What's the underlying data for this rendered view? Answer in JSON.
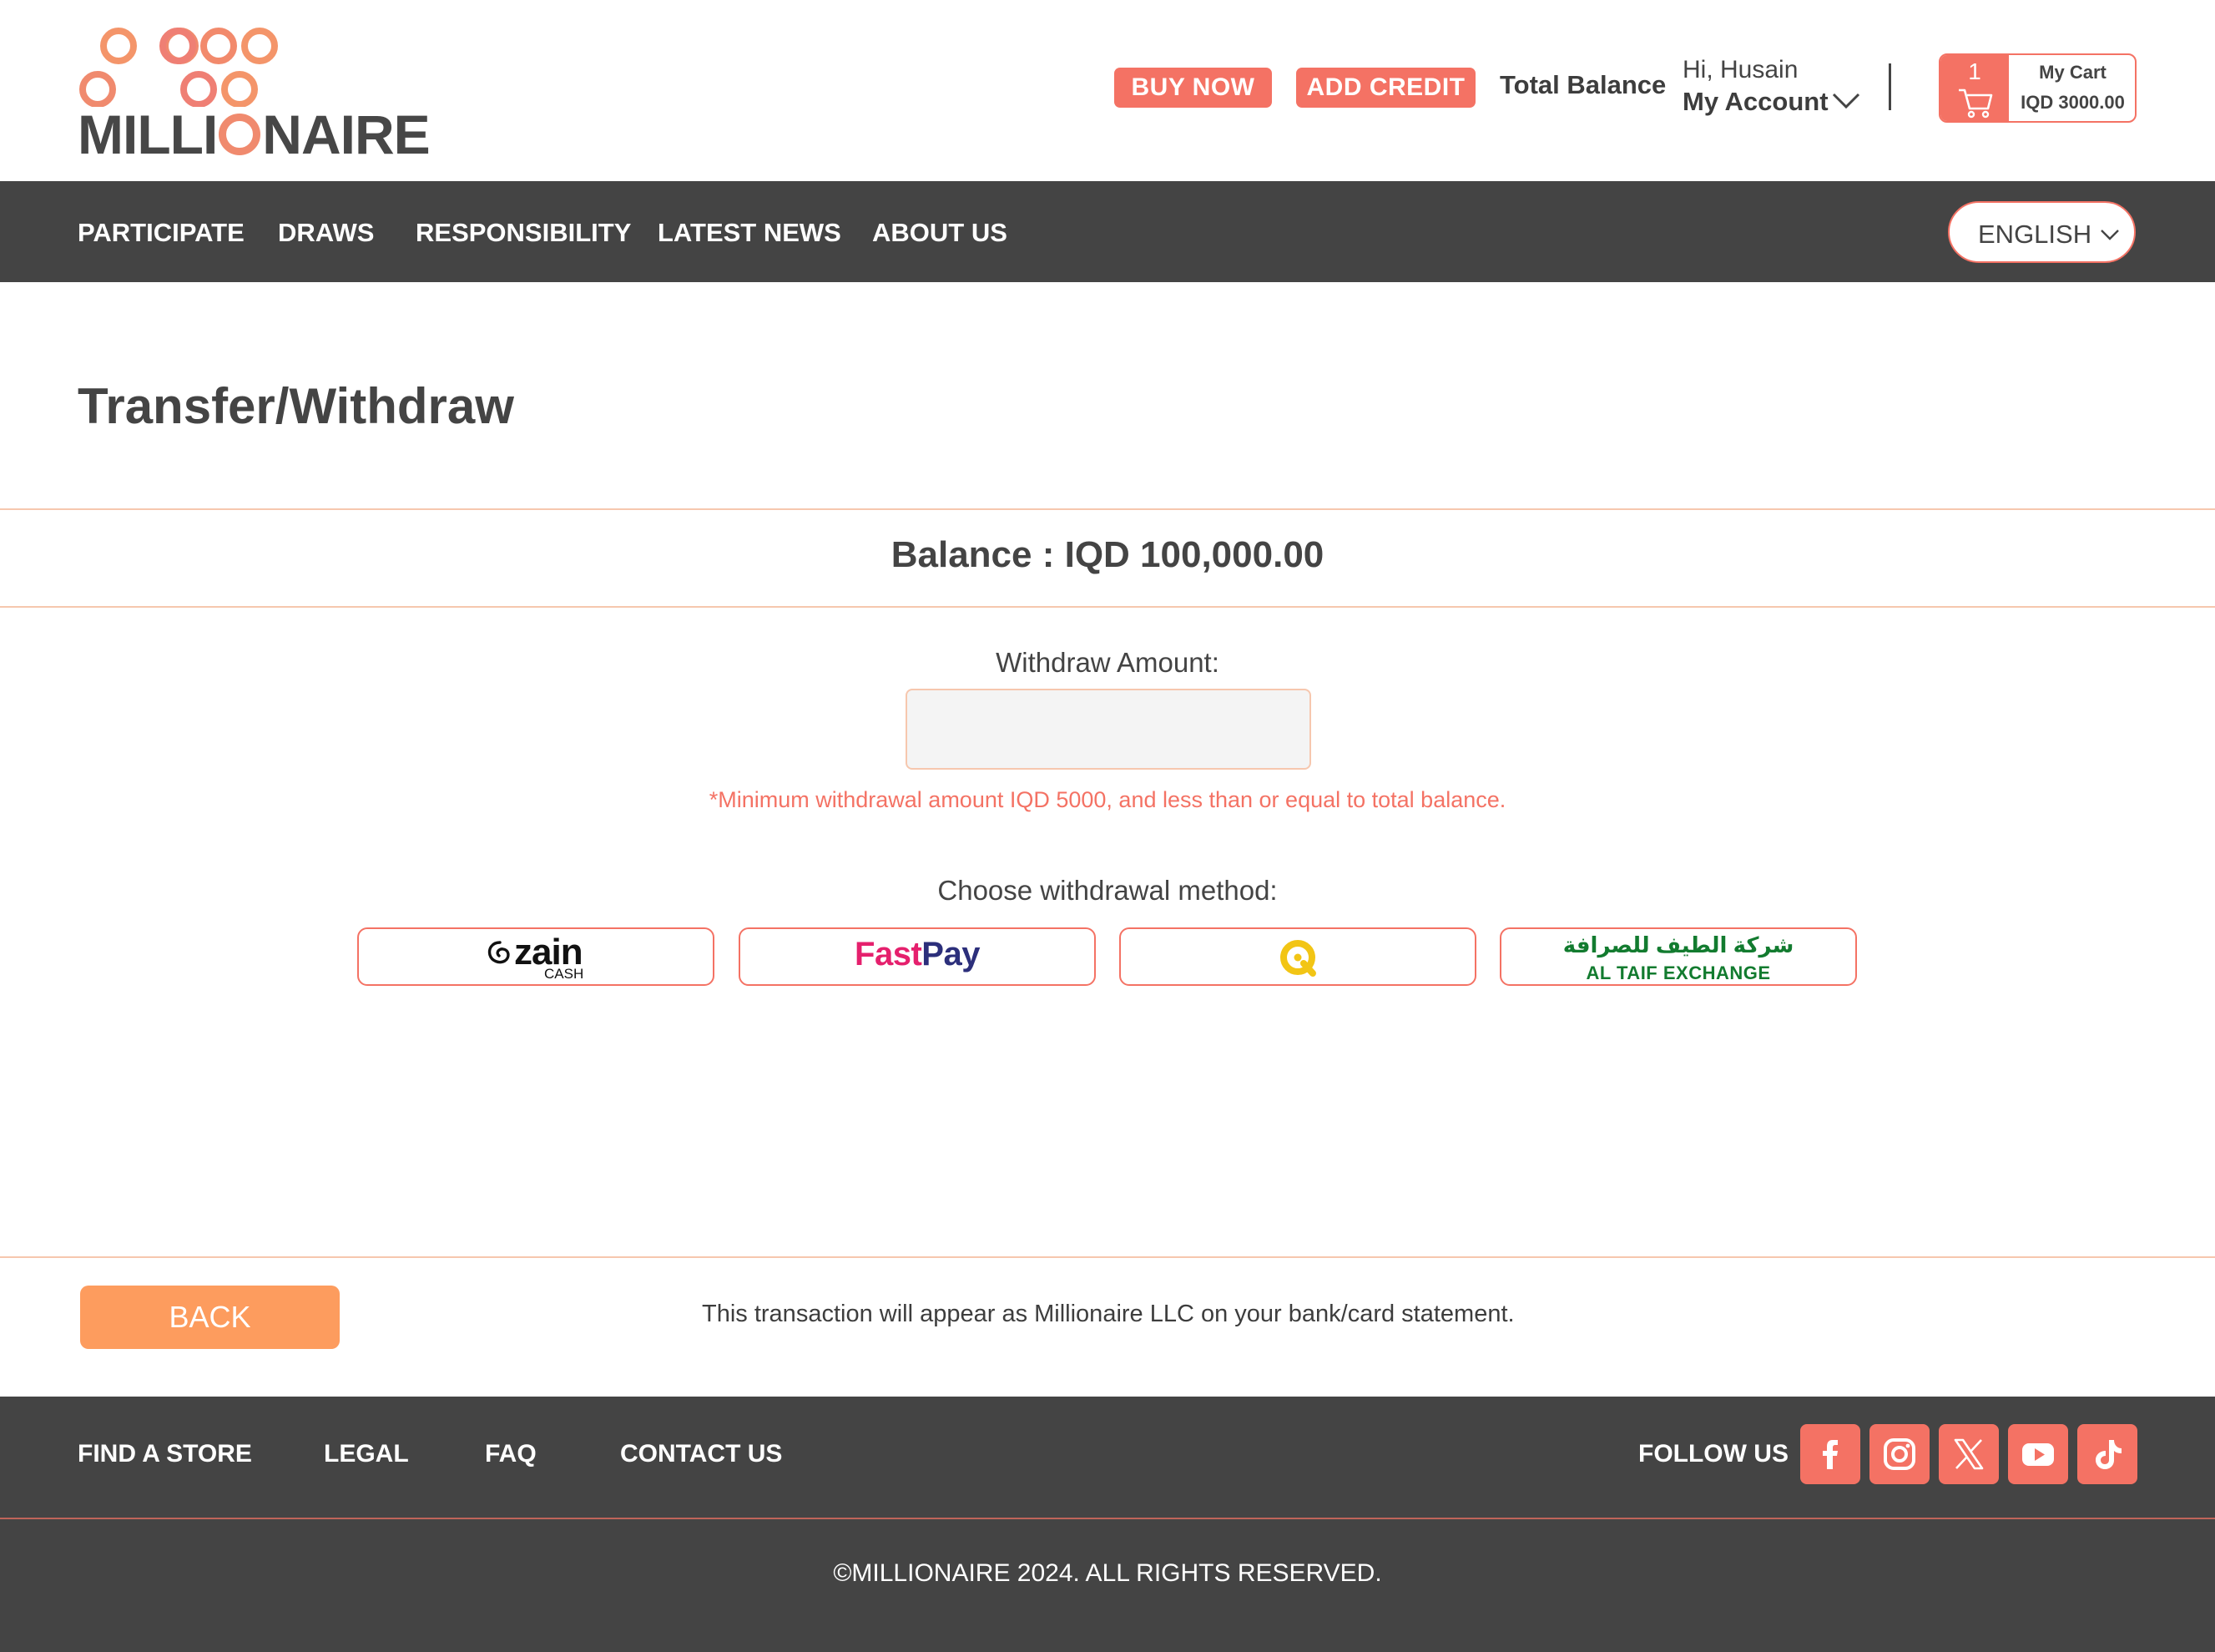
{
  "header": {
    "logo_text_before": "MILLI",
    "logo_text_after": "NAIRE",
    "buy_now": "BUY NOW",
    "add_credit": "ADD CREDIT",
    "total_balance_label": "Total Balance",
    "greeting": "Hi, Husain",
    "account_label": "My Account",
    "cart": {
      "count": "1",
      "title": "My Cart",
      "amount": "IQD 3000.00"
    }
  },
  "nav": {
    "items": [
      "PARTICIPATE",
      "DRAWS",
      "RESPONSIBILITY",
      "LATEST NEWS",
      "ABOUT US"
    ],
    "language": "ENGLISH"
  },
  "main": {
    "title": "Transfer/Withdraw",
    "balance": "Balance : IQD 100,000.00",
    "withdraw_label": "Withdraw Amount:",
    "withdraw_value": "",
    "note": "*Minimum withdrawal amount IQD 5000, and less than or equal to total balance.",
    "method_label": "Choose withdrawal method:",
    "methods": {
      "zain": {
        "word": "zain",
        "sub": "CASH"
      },
      "fastpay": {
        "part1": "Fast",
        "part2": "Pay"
      },
      "qi": {
        "icon": "qi-card-icon"
      },
      "altaif": {
        "arabic": "شركة الطيف للصرافة",
        "english": "AL TAIF EXCHANGE"
      }
    },
    "back": "BACK",
    "statement": "This transaction will appear as Millionaire LLC on your bank/card statement."
  },
  "footer": {
    "links": [
      "FIND A STORE",
      "LEGAL",
      "FAQ",
      "CONTACT US"
    ],
    "follow_label": "FOLLOW US",
    "socials": [
      "facebook-icon",
      "instagram-icon",
      "x-icon",
      "youtube-icon",
      "tiktok-icon"
    ],
    "copyright": "©MILLIONAIRE 2024. ALL RIGHTS RESERVED."
  },
  "colors": {
    "accent": "#f47264",
    "back_button": "#fd9c5e",
    "dark_bar": "#444444",
    "divider": "#f6c7ae"
  }
}
